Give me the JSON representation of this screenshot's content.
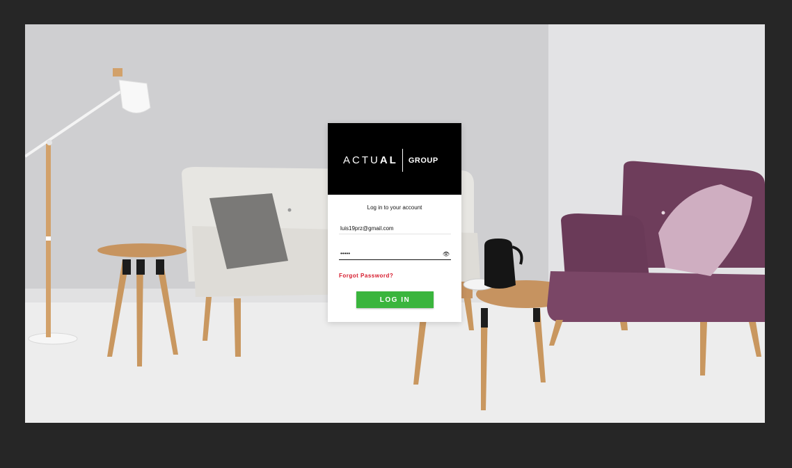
{
  "brand": {
    "word_light": "ACTU",
    "word_bold": "AL",
    "group": "GROUP"
  },
  "form": {
    "subtitle": "Log in to your account",
    "email_value": "luis19prz@gmail.com",
    "password_value": "•••••",
    "password_toggle": "👁",
    "forgot_label": "Forgot Password?",
    "login_label": "LOG IN"
  },
  "colors": {
    "login_button": "#3ab53d",
    "forgot_link": "#d6182a",
    "header_bg": "#000000",
    "frame_bg": "#262626"
  }
}
